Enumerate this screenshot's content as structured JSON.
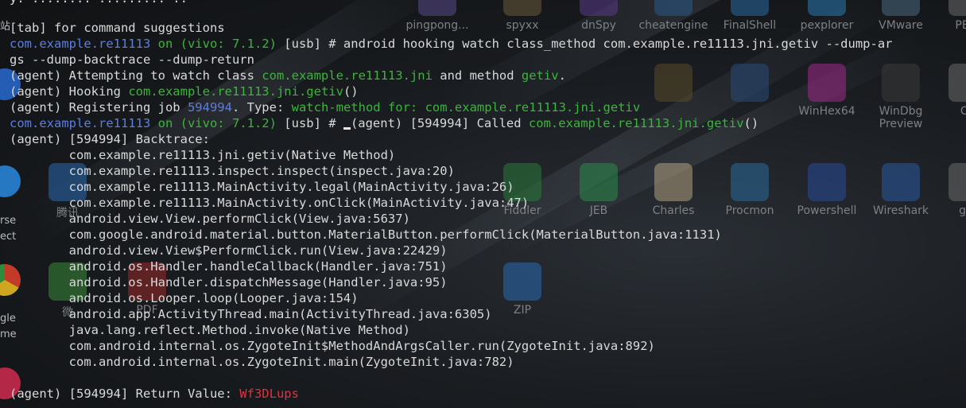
{
  "desktop": {
    "top_icons": [
      {
        "label": "pingpong...",
        "color": "#5a4a8a"
      },
      {
        "label": "spyxx",
        "color": "#6a5a3a"
      },
      {
        "label": "dnSpy",
        "color": "#5a3a8a"
      },
      {
        "label": "cheatengine",
        "color": "#2a5a8a"
      },
      {
        "label": "FinalShell",
        "color": "#2a6aa0"
      },
      {
        "label": "pexplorer",
        "color": "#2a7ab0"
      },
      {
        "label": "VMware",
        "color": "#4a6a80"
      },
      {
        "label": "PE-b",
        "color": "#6a6a6a"
      }
    ],
    "mid_icons": [
      {
        "label": "",
        "color": "#5a4a2a"
      },
      {
        "label": "",
        "color": "#2a4a7a"
      },
      {
        "label": "",
        "color": "#2a7a3a"
      },
      {
        "label": "WinHex64",
        "color": "#a02a8a"
      },
      {
        "label": "WinDbg",
        "sub": "Preview",
        "color": "#3a3a3a"
      },
      {
        "label": "CT",
        "color": "#6a6a6a"
      }
    ],
    "row3_icons": [
      {
        "label": "腾讯",
        "color": "#2a6ab0"
      },
      {
        "label": "Fiddler",
        "color": "#2a7a3a"
      },
      {
        "label": "JEB",
        "color": "#2a8a4a"
      },
      {
        "label": "Charles",
        "color": "#b0a080"
      },
      {
        "label": "Procmon",
        "color": "#2a6a9a"
      },
      {
        "label": "Powershell",
        "color": "#2a4a9a"
      },
      {
        "label": "Wireshark",
        "color": "#2a5aa0"
      },
      {
        "label": "ghi",
        "color": "#6a6a6a"
      }
    ],
    "row4_icons": [
      {
        "label": "微",
        "color": "#3a8a3a"
      },
      {
        "label": "PDF",
        "color": "#9a2a2a"
      },
      {
        "label": "ZIP",
        "color": "#2a6ab0"
      }
    ],
    "side_labels": [
      "站",
      "rse",
      "ect",
      "gle",
      "me"
    ]
  },
  "terminal": {
    "lines": [
      [
        {
          "t": "y: ........ ......... ..",
          "c": "w"
        }
      ],
      [
        {
          "t": "[tab] for command suggestions",
          "c": "w"
        }
      ],
      [
        {
          "t": "com.example.re11113 ",
          "c": "b"
        },
        {
          "t": "on (vivo: 7.1.2) ",
          "c": "g"
        },
        {
          "t": "[usb] # android hooking watch class_method com.example.re11113.jni.getiv --dump-ar",
          "c": "w"
        }
      ],
      [
        {
          "t": "gs --dump-backtrace --dump-return",
          "c": "w"
        }
      ],
      [
        {
          "t": "(agent) Attempting to watch class ",
          "c": "w"
        },
        {
          "t": "com.example.re11113.jni",
          "c": "g"
        },
        {
          "t": " and method ",
          "c": "w"
        },
        {
          "t": "getiv",
          "c": "g"
        },
        {
          "t": ".",
          "c": "w"
        }
      ],
      [
        {
          "t": "(agent) Hooking ",
          "c": "w"
        },
        {
          "t": "com.example.re11113.jni.getiv",
          "c": "g"
        },
        {
          "t": "()",
          "c": "w"
        }
      ],
      [
        {
          "t": "(agent) Registering job ",
          "c": "w"
        },
        {
          "t": "594994",
          "c": "b"
        },
        {
          "t": ". Type: ",
          "c": "w"
        },
        {
          "t": "watch-method for: com.example.re11113.jni.getiv",
          "c": "g"
        }
      ],
      [
        {
          "t": "com.example.re11113 ",
          "c": "b"
        },
        {
          "t": "on (vivo: 7.1.2) ",
          "c": "g"
        },
        {
          "t": "[usb] # ",
          "c": "w"
        },
        {
          "t": "CURSOR",
          "c": "cursor"
        },
        {
          "t": "(agent) [594994] Called ",
          "c": "w"
        },
        {
          "t": "com.example.re11113.jni.getiv",
          "c": "g"
        },
        {
          "t": "()",
          "c": "w"
        }
      ],
      [
        {
          "t": "(agent) [594994] Backtrace:",
          "c": "w"
        }
      ],
      [
        {
          "t": "        com.example.re11113.jni.getiv(Native Method)",
          "c": "w"
        }
      ],
      [
        {
          "t": "        com.example.re11113.inspect.inspect(inspect.java:20)",
          "c": "w"
        }
      ],
      [
        {
          "t": "        com.example.re11113.MainActivity.legal(MainActivity.java:26)",
          "c": "w"
        }
      ],
      [
        {
          "t": "        com.example.re11113.MainActivity.onClick(MainActivity.java:47)",
          "c": "w"
        }
      ],
      [
        {
          "t": "        android.view.View.performClick(View.java:5637)",
          "c": "w"
        }
      ],
      [
        {
          "t": "        com.google.android.material.button.MaterialButton.performClick(MaterialButton.java:1131)",
          "c": "w"
        }
      ],
      [
        {
          "t": "        android.view.View$PerformClick.run(View.java:22429)",
          "c": "w"
        }
      ],
      [
        {
          "t": "        android.os.Handler.handleCallback(Handler.java:751)",
          "c": "w"
        }
      ],
      [
        {
          "t": "        android.os.Handler.dispatchMessage(Handler.java:95)",
          "c": "w"
        }
      ],
      [
        {
          "t": "        android.os.Looper.loop(Looper.java:154)",
          "c": "w"
        }
      ],
      [
        {
          "t": "        android.app.ActivityThread.main(ActivityThread.java:6305)",
          "c": "w"
        }
      ],
      [
        {
          "t": "        java.lang.reflect.Method.invoke(Native Method)",
          "c": "w"
        }
      ],
      [
        {
          "t": "        com.android.internal.os.ZygoteInit$MethodAndArgsCaller.run(ZygoteInit.java:892)",
          "c": "w"
        }
      ],
      [
        {
          "t": "        com.android.internal.os.ZygoteInit.main(ZygoteInit.java:782)",
          "c": "w"
        }
      ],
      [
        {
          "t": "",
          "c": "w"
        }
      ],
      [
        {
          "t": "(agent) [594994] Return Value: ",
          "c": "w"
        },
        {
          "t": "Wf3DLups",
          "c": "r"
        }
      ]
    ]
  }
}
